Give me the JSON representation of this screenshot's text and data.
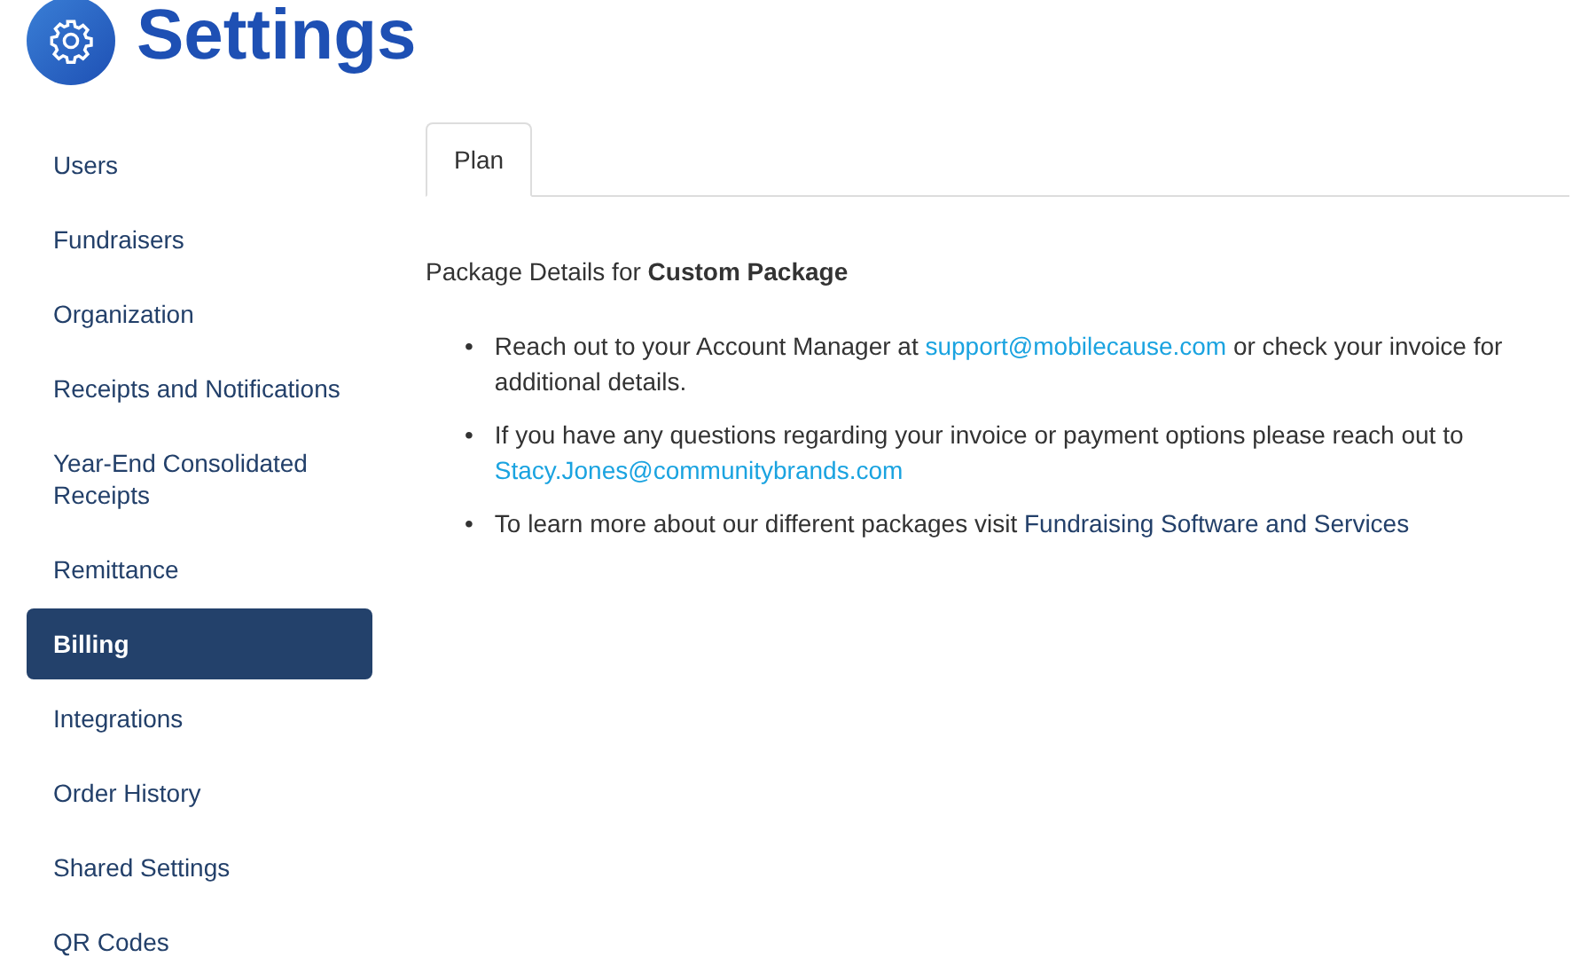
{
  "header": {
    "title": "Settings"
  },
  "sidebar": {
    "items": [
      {
        "label": "Users",
        "selected": false
      },
      {
        "label": "Fundraisers",
        "selected": false
      },
      {
        "label": "Organization",
        "selected": false
      },
      {
        "label": "Receipts and Notifications",
        "selected": false
      },
      {
        "label": "Year-End Consolidated Receipts",
        "selected": false
      },
      {
        "label": "Remittance",
        "selected": false
      },
      {
        "label": "Billing",
        "selected": true
      },
      {
        "label": "Integrations",
        "selected": false
      },
      {
        "label": "Order History",
        "selected": false
      },
      {
        "label": "Shared Settings",
        "selected": false
      },
      {
        "label": "QR Codes",
        "selected": false
      }
    ]
  },
  "tabs": [
    {
      "label": "Plan",
      "selected": true
    }
  ],
  "package_details": "Package Details for **Custom Package**",
  "bullets": [
    {
      "marker": "•",
      "parts": [
        {
          "kind": "text",
          "text": "Reach out to your Account Manager at "
        },
        {
          "kind": "email",
          "text": "support@mobilecause.com"
        },
        {
          "kind": "text",
          "text": " or check your invoice for additional details."
        }
      ]
    },
    {
      "marker": "•",
      "parts": [
        {
          "kind": "text",
          "text": "If you have any questions regarding your invoice or payment options please reach out to "
        },
        {
          "kind": "email",
          "text": "Stacy.Jones@communitybrands.com"
        }
      ]
    },
    {
      "marker": "•",
      "parts": [
        {
          "kind": "text",
          "text": "To learn more about our different packages visit "
        },
        {
          "kind": "page",
          "text": "Fundraising Software and Services"
        }
      ]
    }
  ]
}
